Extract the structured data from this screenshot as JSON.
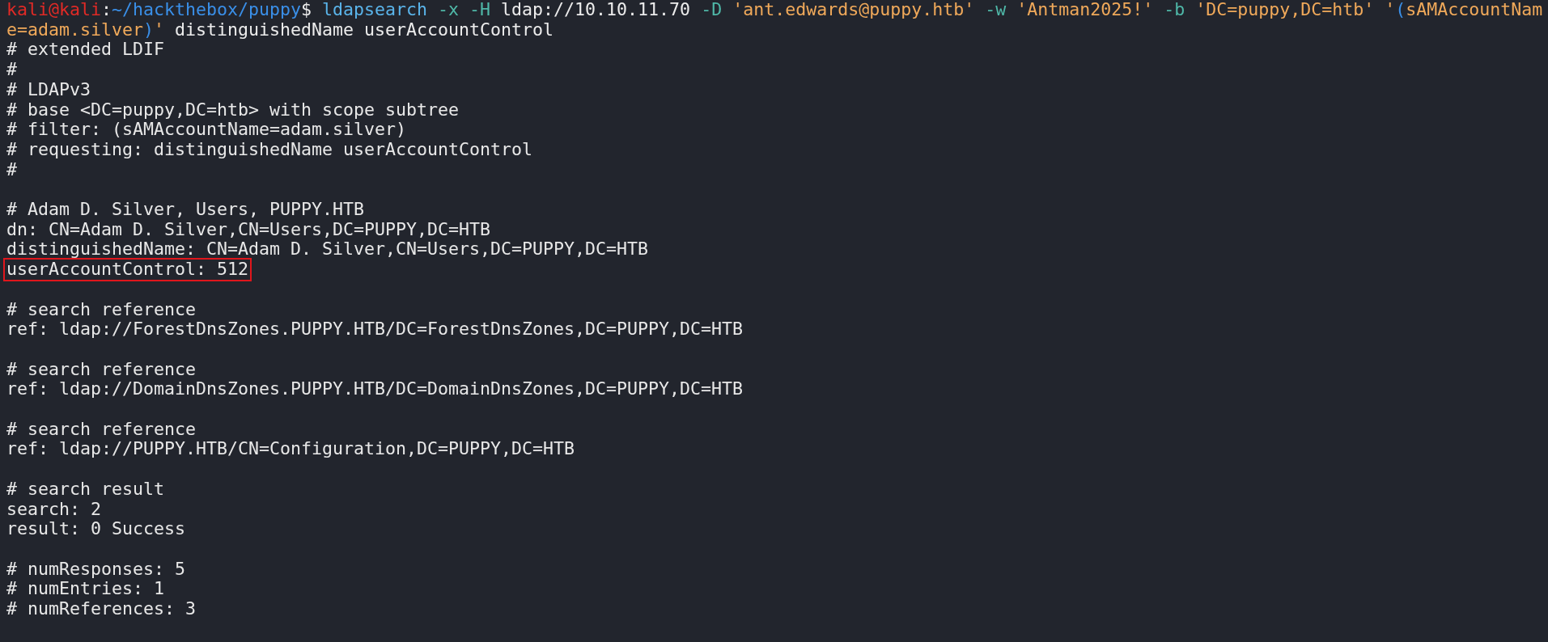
{
  "terminal": {
    "lines": [
      {
        "kind": "command",
        "segments": [
          {
            "kind": "user",
            "text": "kali@kali"
          },
          {
            "kind": "plain",
            "text": ":"
          },
          {
            "kind": "path",
            "text": "~/hackthebox/puppy"
          },
          {
            "kind": "plain",
            "text": "$ "
          },
          {
            "kind": "program",
            "text": "ldapsearch "
          },
          {
            "kind": "option",
            "text": "-x "
          },
          {
            "kind": "option",
            "text": "-H "
          },
          {
            "kind": "plain",
            "text": "ldap://10.10.11.70 "
          },
          {
            "kind": "option",
            "text": "-D "
          },
          {
            "kind": "string",
            "text": "'ant.edwards@puppy.htb' "
          },
          {
            "kind": "option",
            "text": "-w "
          },
          {
            "kind": "string",
            "text": "'Antman2025!' "
          },
          {
            "kind": "option",
            "text": "-b "
          },
          {
            "kind": "string",
            "text": "'DC=puppy,DC=htb' '"
          },
          {
            "kind": "paren",
            "text": "("
          },
          {
            "kind": "string",
            "text": "sAMAccountName=adam.silver"
          },
          {
            "kind": "paren",
            "text": ")"
          },
          {
            "kind": "string",
            "text": "'"
          },
          {
            "kind": "plain",
            "text": " distinguishedName userAccountControl"
          }
        ]
      },
      {
        "kind": "output",
        "text": "# extended LDIF",
        "highlighted": false
      },
      {
        "kind": "output",
        "text": "#",
        "highlighted": false
      },
      {
        "kind": "output",
        "text": "# LDAPv3",
        "highlighted": false
      },
      {
        "kind": "output",
        "text": "# base <DC=puppy,DC=htb> with scope subtree",
        "highlighted": false
      },
      {
        "kind": "output",
        "text": "# filter: (sAMAccountName=adam.silver)",
        "highlighted": false
      },
      {
        "kind": "output",
        "text": "# requesting: distinguishedName userAccountControl",
        "highlighted": false
      },
      {
        "kind": "output",
        "text": "#",
        "highlighted": false
      },
      {
        "kind": "blank"
      },
      {
        "kind": "output",
        "text": "# Adam D. Silver, Users, PUPPY.HTB",
        "highlighted": false
      },
      {
        "kind": "output",
        "text": "dn: CN=Adam D. Silver,CN=Users,DC=PUPPY,DC=HTB",
        "highlighted": false
      },
      {
        "kind": "output",
        "text": "distinguishedName: CN=Adam D. Silver,CN=Users,DC=PUPPY,DC=HTB",
        "highlighted": false
      },
      {
        "kind": "output",
        "text": "userAccountControl: 512",
        "highlighted": true
      },
      {
        "kind": "blank"
      },
      {
        "kind": "output",
        "text": "# search reference",
        "highlighted": false
      },
      {
        "kind": "output",
        "text": "ref: ldap://ForestDnsZones.PUPPY.HTB/DC=ForestDnsZones,DC=PUPPY,DC=HTB",
        "highlighted": false
      },
      {
        "kind": "blank"
      },
      {
        "kind": "output",
        "text": "# search reference",
        "highlighted": false
      },
      {
        "kind": "output",
        "text": "ref: ldap://DomainDnsZones.PUPPY.HTB/DC=DomainDnsZones,DC=PUPPY,DC=HTB",
        "highlighted": false
      },
      {
        "kind": "blank"
      },
      {
        "kind": "output",
        "text": "# search reference",
        "highlighted": false
      },
      {
        "kind": "output",
        "text": "ref: ldap://PUPPY.HTB/CN=Configuration,DC=PUPPY,DC=HTB",
        "highlighted": false
      },
      {
        "kind": "blank"
      },
      {
        "kind": "output",
        "text": "# search result",
        "highlighted": false
      },
      {
        "kind": "output",
        "text": "search: 2",
        "highlighted": false
      },
      {
        "kind": "output",
        "text": "result: 0 Success",
        "highlighted": false
      },
      {
        "kind": "blank"
      },
      {
        "kind": "output",
        "text": "# numResponses: 5",
        "highlighted": false
      },
      {
        "kind": "output",
        "text": "# numEntries: 1",
        "highlighted": false
      },
      {
        "kind": "output",
        "text": "# numReferences: 3",
        "highlighted": false
      }
    ]
  }
}
